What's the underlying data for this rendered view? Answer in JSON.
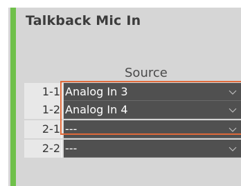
{
  "panel": {
    "title": "Talkback Mic In",
    "source_header": "Source"
  },
  "rows": [
    {
      "label": "1-1",
      "value": "Analog In 3",
      "icon": "chevron-down-icon"
    },
    {
      "label": "1-2",
      "value": "Analog In 4",
      "icon": "chevron-down-icon"
    },
    {
      "label": "2-1",
      "value": "---",
      "icon": "chevron-down-icon"
    },
    {
      "label": "2-2",
      "value": "---",
      "icon": "chevron-down-icon"
    }
  ],
  "colors": {
    "accent": "#6fc04a",
    "highlight": "#e06a3a",
    "select_background": "#505050",
    "panel_background": "#d6d6d6"
  }
}
